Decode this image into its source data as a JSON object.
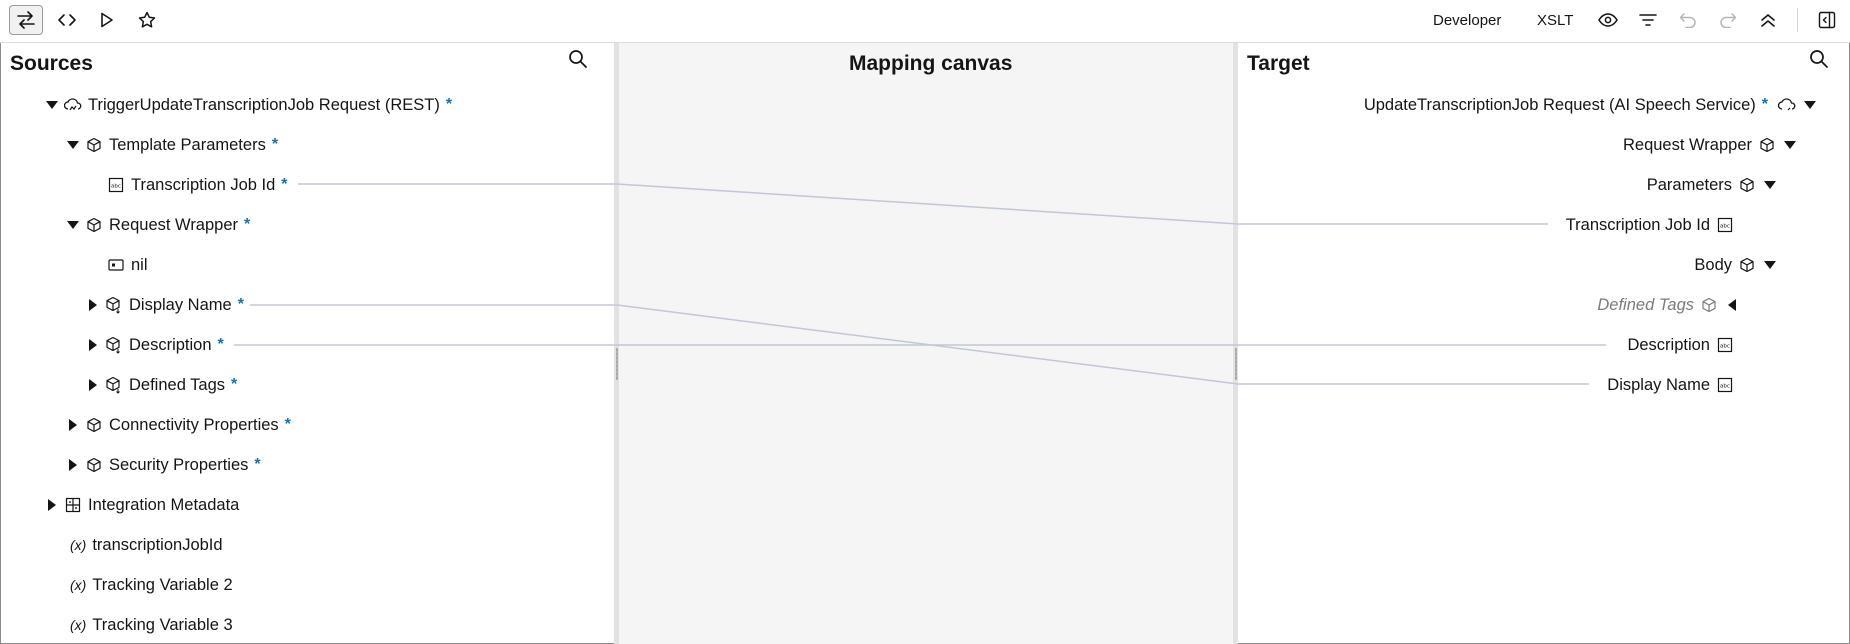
{
  "toolbar": {
    "left_icons": [
      "swap-icon",
      "code-icon",
      "play-icon",
      "star-icon"
    ],
    "developer_label": "Developer",
    "xslt_label": "XSLT",
    "right_icons": [
      "eye-icon",
      "filter-icon",
      "undo-icon",
      "redo-icon",
      "collapse-icon",
      "panel-toggle-icon"
    ]
  },
  "sources": {
    "title": "Sources",
    "items": [
      {
        "label": "TriggerUpdateTranscriptionJob Request (REST)",
        "required": "*"
      },
      {
        "label": "Template Parameters",
        "required": "*"
      },
      {
        "label": "Transcription Job Id",
        "required": "*"
      },
      {
        "label": "Request Wrapper",
        "required": "*"
      },
      {
        "label": "nil",
        "required": ""
      },
      {
        "label": "Display Name",
        "required": "*"
      },
      {
        "label": "Description",
        "required": "*"
      },
      {
        "label": "Defined Tags",
        "required": "*"
      },
      {
        "label": "Connectivity Properties",
        "required": "*"
      },
      {
        "label": "Security Properties",
        "required": "*"
      },
      {
        "label": "Integration Metadata",
        "required": ""
      },
      {
        "label": "transcriptionJobId",
        "prefix": "(x)"
      },
      {
        "label": "Tracking Variable 2",
        "prefix": "(x)"
      },
      {
        "label": "Tracking Variable 3",
        "prefix": "(x)"
      }
    ]
  },
  "canvas": {
    "title": "Mapping canvas"
  },
  "target": {
    "title": "Target",
    "items": [
      {
        "label": "UpdateTranscriptionJob Request (AI Speech Service)",
        "required": "*"
      },
      {
        "label": "Request Wrapper"
      },
      {
        "label": "Parameters"
      },
      {
        "label": "Transcription Job Id"
      },
      {
        "label": "Body"
      },
      {
        "label": "Defined Tags"
      },
      {
        "label": "Description"
      },
      {
        "label": "Display Name"
      }
    ]
  },
  "colors": {
    "required": "#1b6fa8",
    "mapping_line": "#c2c7d6",
    "canvas_bg": "#f5f5f5"
  }
}
